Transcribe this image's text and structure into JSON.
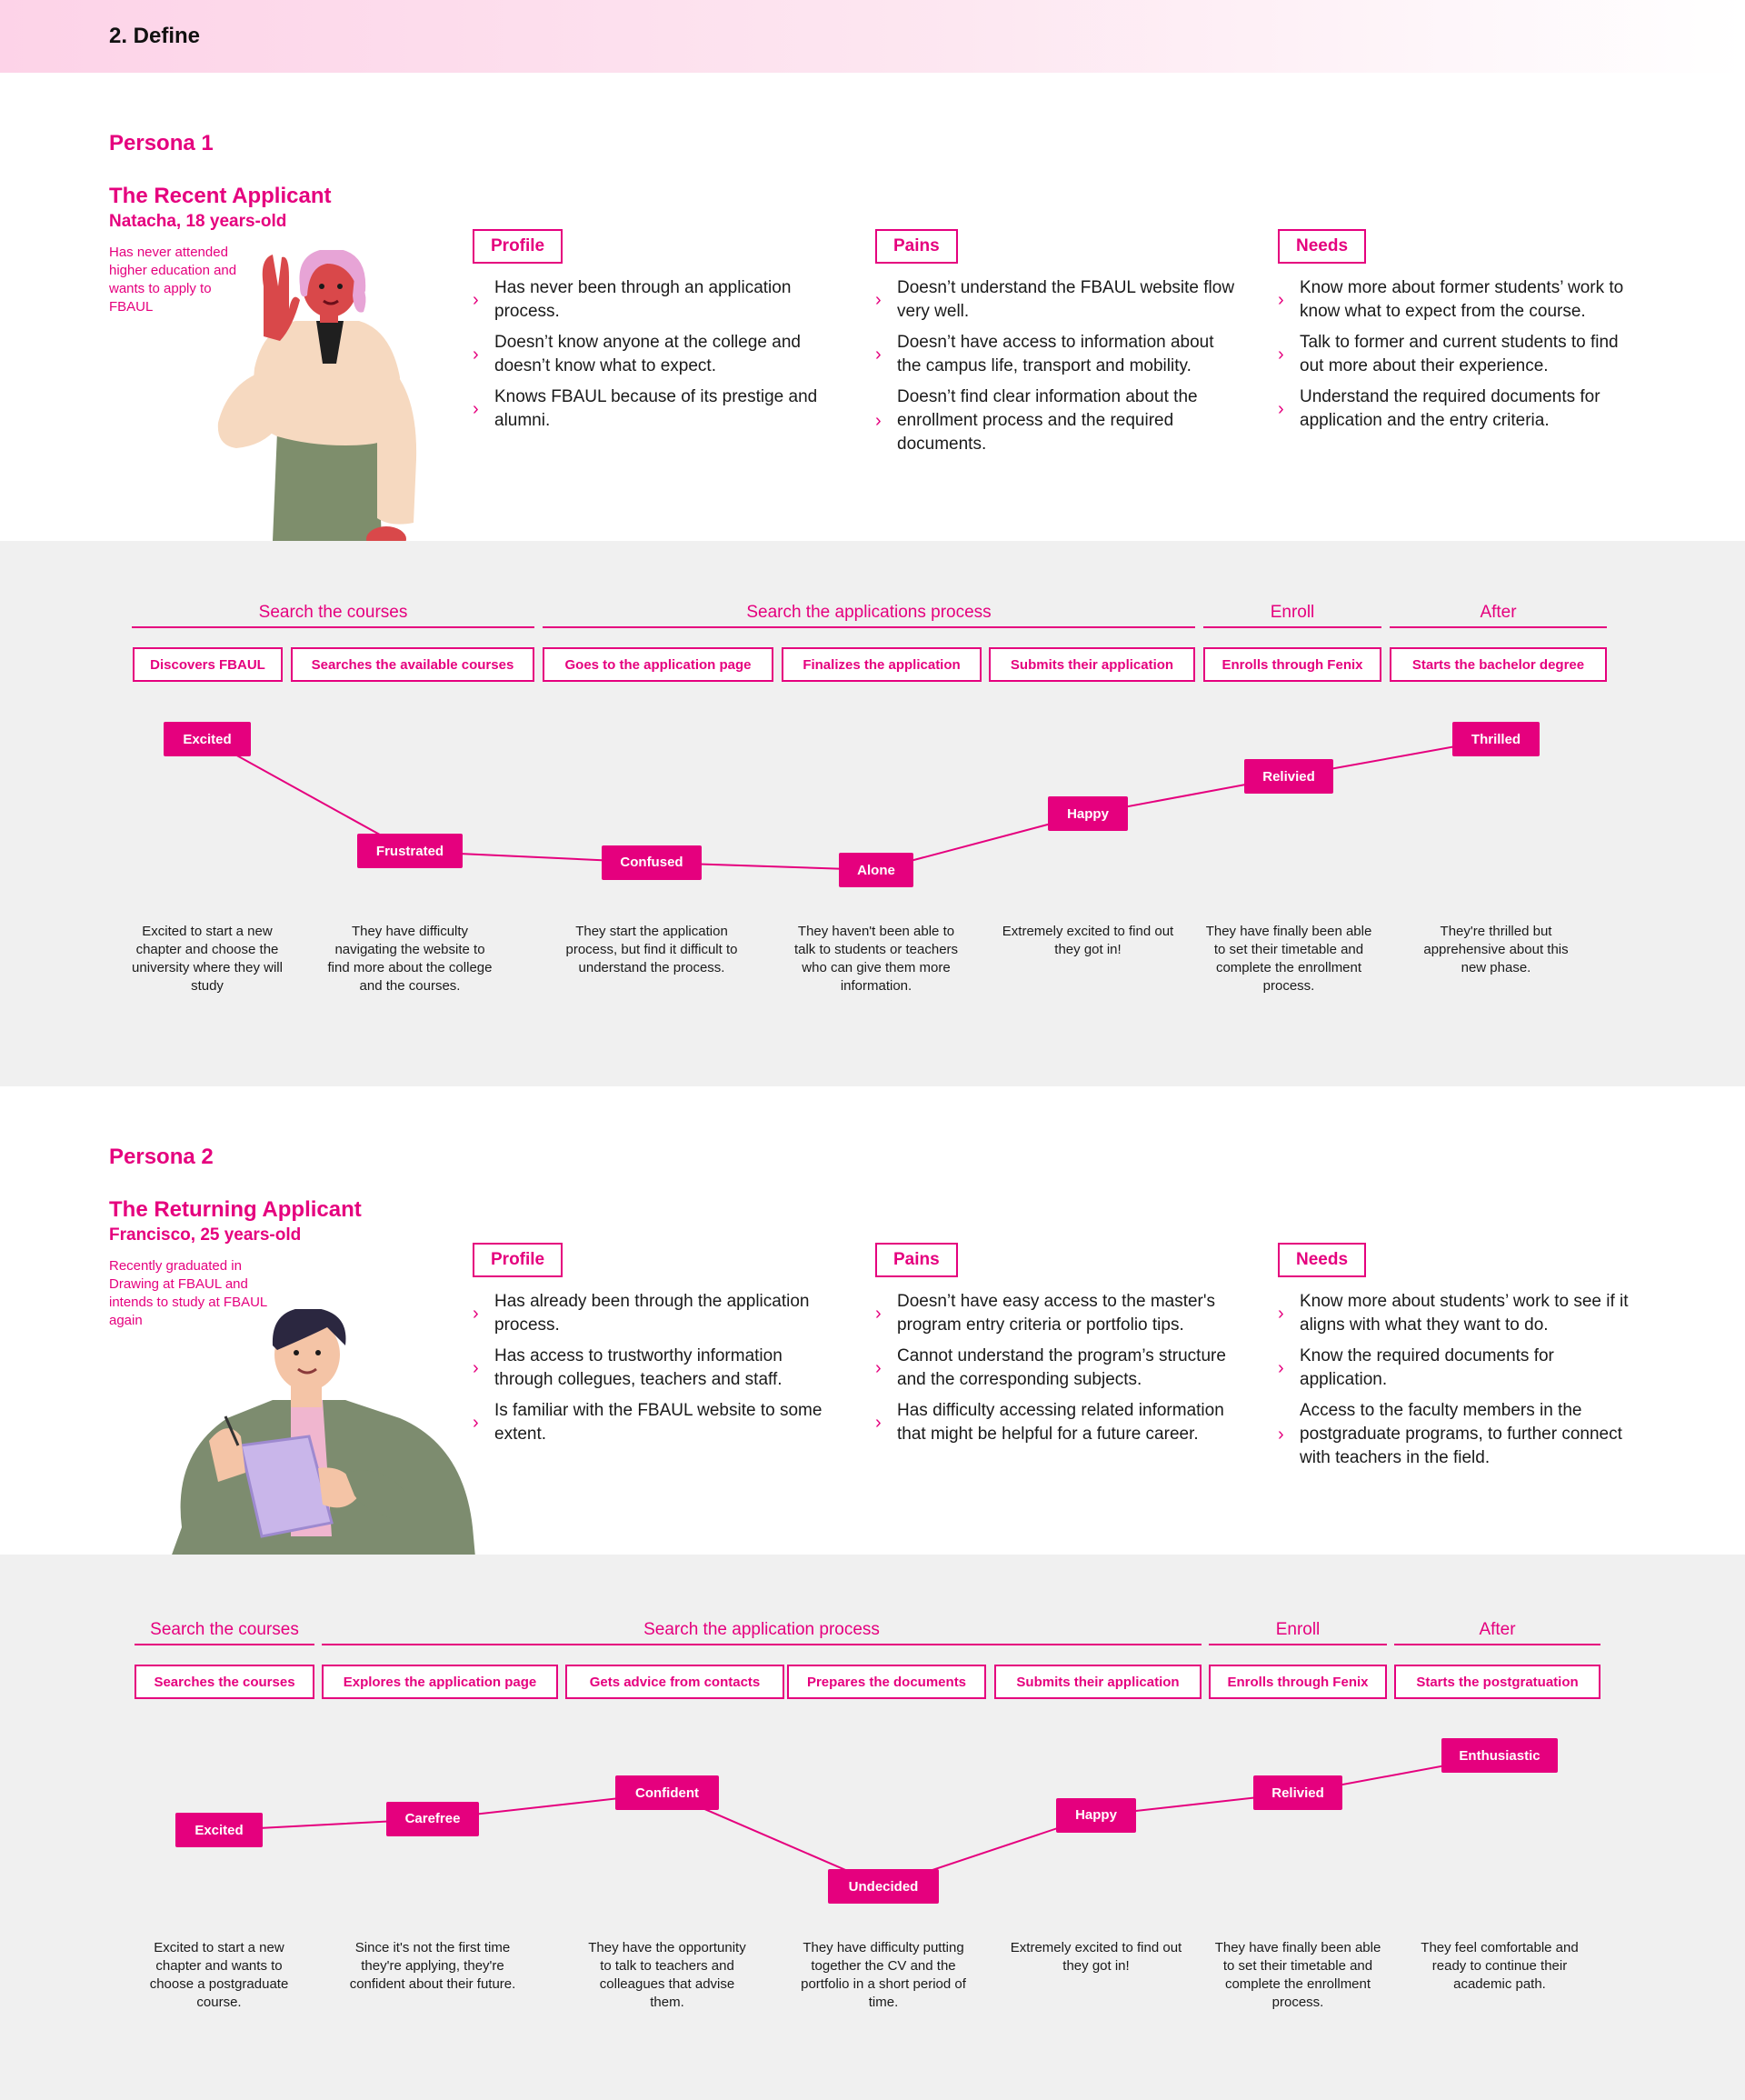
{
  "section": {
    "title": "2.   Define"
  },
  "colors": {
    "accent": "#e5007e",
    "band": "#f0f0f0",
    "text": "#1a1a1a"
  },
  "persona1": {
    "label": "Persona 1",
    "name": "The Recent Applicant",
    "age": "Natacha, 18 years-old",
    "desc": "Has never attended higher education and wants to apply to FBAUL",
    "illustration": "waving-girl-illustration",
    "profile": {
      "title": "Profile",
      "items": [
        "Has never been through an application process.",
        "Doesn’t know anyone at the college and doesn’t know what to expect.",
        "Knows FBAUL because of its prestige and alumni."
      ]
    },
    "pains": {
      "title": "Pains",
      "items": [
        "Doesn’t understand the FBAUL website flow very well.",
        "Doesn’t have access to information about the campus life, transport and mobility.",
        "Doesn’t find clear information about the enrollment process and the required documents."
      ]
    },
    "needs": {
      "title": "Needs",
      "items": [
        "Know more about former students’ work to know what to expect from the course.",
        "Talk to former and current students to find out more about their experience.",
        "Understand the required documents for application and the entry criteria."
      ]
    },
    "stages": [
      "Search the courses",
      "Search the applications process",
      "Enroll",
      "After"
    ],
    "steps": [
      "Discovers FBAUL",
      "Searches the available courses",
      "Goes to the application page",
      "Finalizes the application",
      "Submits their application",
      "Enrolls through Fenix",
      "Starts the bachelor degree"
    ],
    "emotions": [
      "Excited",
      "Frustrated",
      "Confused",
      "Alone",
      "Happy",
      "Relivied",
      "Thrilled"
    ],
    "emotion_levels": [
      5,
      2,
      1.7,
      1.5,
      3,
      4,
      5
    ],
    "notes": [
      "Excited to start a new chapter and choose the university where they will study",
      "They have difficulty navigating the website to find more about the college and the courses.",
      "They start the application process, but find it difficult to understand the process.",
      "They haven't been able to talk to students or teachers who can give them more information.",
      "Extremely excited to find out they got in!",
      "They have finally been able to set their timetable and complete the enrollment process.",
      "They're thrilled but apprehensive about this new phase."
    ]
  },
  "persona2": {
    "label": "Persona 2",
    "name": "The Returning Applicant",
    "age": "Francisco, 25 years-old",
    "desc": "Recently graduated in Drawing at FBAUL and intends to study at FBAUL again",
    "illustration": "man-with-tablet-illustration",
    "profile": {
      "title": "Profile",
      "items": [
        "Has already been through the application process.",
        "Has access to trustworthy information through collegues, teachers and staff.",
        "Is familiar with the FBAUL website to some extent."
      ]
    },
    "pains": {
      "title": "Pains",
      "items": [
        "Doesn’t have easy access to the master's program entry criteria or portfolio tips.",
        "Cannot understand the program’s structure and the corresponding subjects.",
        "Has difficulty accessing related information that might be helpful for a future career."
      ]
    },
    "needs": {
      "title": "Needs",
      "items": [
        "Know more about students’ work to see if it aligns with what they want to do.",
        "Know the required documents for application.",
        "Access to the faculty members in the postgraduate programs, to further connect with teachers in the field."
      ]
    },
    "stages": [
      "Search the courses",
      "Search the application process",
      "Enroll",
      "After"
    ],
    "steps": [
      "Searches the courses",
      "Explores the application page",
      "Gets advice from contacts",
      "Prepares the documents",
      "Submits their application",
      "Enrolls through Fenix",
      "Starts the postgratuation"
    ],
    "emotions": [
      "Excited",
      "Carefree",
      "Confident",
      "Undecided",
      "Happy",
      "Relivied",
      "Enthusiastic"
    ],
    "emotion_levels": [
      3,
      3.3,
      4,
      1.5,
      3.4,
      4,
      5
    ],
    "notes": [
      "Excited to start a new chapter and wants to choose a postgraduate course.",
      "Since it's not the first time they're applying, they're confident about their future.",
      "They have the opportunity to talk to teachers and colleagues that advise them.",
      "They have difficulty putting together the CV and the portfolio in a short period of time.",
      "Extremely excited to find out they got in!",
      "They have finally been able to set their timetable and complete the enrollment process.",
      "They feel comfortable and ready to continue their academic path."
    ]
  }
}
